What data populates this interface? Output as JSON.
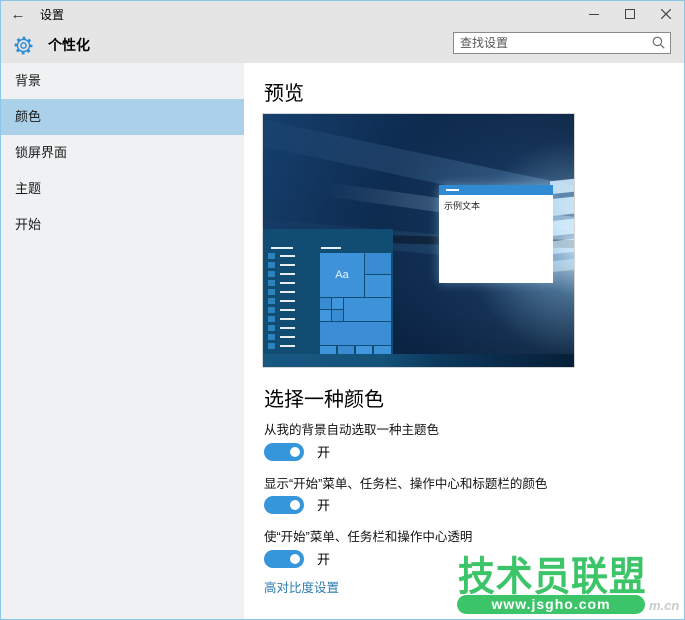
{
  "window": {
    "title": "设置",
    "back_label": "←"
  },
  "header": {
    "title": "个性化",
    "search_placeholder": "查找设置"
  },
  "sidebar": {
    "items": [
      {
        "label": "背景",
        "selected": false
      },
      {
        "label": "颜色",
        "selected": true
      },
      {
        "label": "锁屏界面",
        "selected": false
      },
      {
        "label": "主题",
        "selected": false
      },
      {
        "label": "开始",
        "selected": false
      }
    ]
  },
  "main": {
    "preview_heading": "预览",
    "preview": {
      "sample_window_text": "示例文本",
      "tile_label": "Aa"
    },
    "color_heading": "选择一种颜色",
    "toggles": [
      {
        "label": "从我的背景自动选取一种主题色",
        "state": "开"
      },
      {
        "label": "显示“开始”菜单、任务栏、操作中心和标题栏的颜色",
        "state": "开"
      },
      {
        "label": "使“开始”菜单、任务栏和操作中心透明",
        "state": "开"
      }
    ],
    "link": "高对比度设置"
  },
  "watermark": {
    "title": "技术员联盟",
    "url": "www.jsgho.com",
    "suffix": "m.cn"
  },
  "colors": {
    "accent_toggle": "#3596db",
    "sidebar_selected": "#aad1e9",
    "link": "#2f7cad",
    "watermark_green": "#3cc468",
    "titlebar_bg": "#e5e5e5",
    "preview_tile_blue": "#3e92da"
  }
}
